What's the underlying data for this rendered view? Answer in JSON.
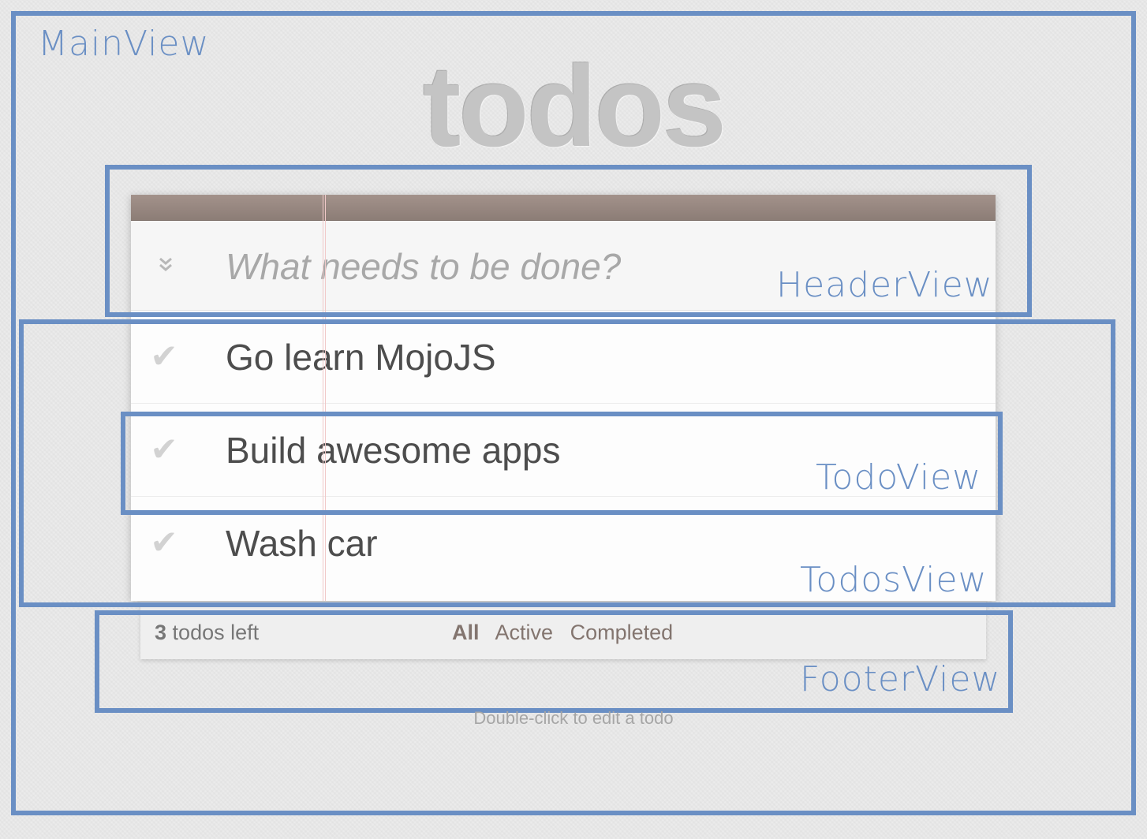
{
  "app": {
    "title": "todos",
    "info_text": "Double-click to edit a todo"
  },
  "header": {
    "new_todo_placeholder": "What needs to be done?",
    "toggle_all_icon": "double-chevron-down-icon"
  },
  "todos": [
    {
      "label": "Go learn MojoJS",
      "completed": false
    },
    {
      "label": "Build awesome apps",
      "completed": false
    },
    {
      "label": "Wash car",
      "completed": false
    }
  ],
  "footer": {
    "count": "3",
    "count_suffix": "todos left",
    "filters": [
      {
        "label": "All",
        "selected": true
      },
      {
        "label": "Active",
        "selected": false
      },
      {
        "label": "Completed",
        "selected": false
      }
    ]
  },
  "annotations": {
    "main_view": "MainView",
    "header_view": "HeaderView",
    "todos_view": "TodosView",
    "todo_view": "TodoView",
    "footer_view": "FooterView"
  },
  "colors": {
    "annotation": "#6a8fc4",
    "topbar": "#8c7d76",
    "title": "#c4c4c4",
    "filter_text": "#83756f"
  }
}
